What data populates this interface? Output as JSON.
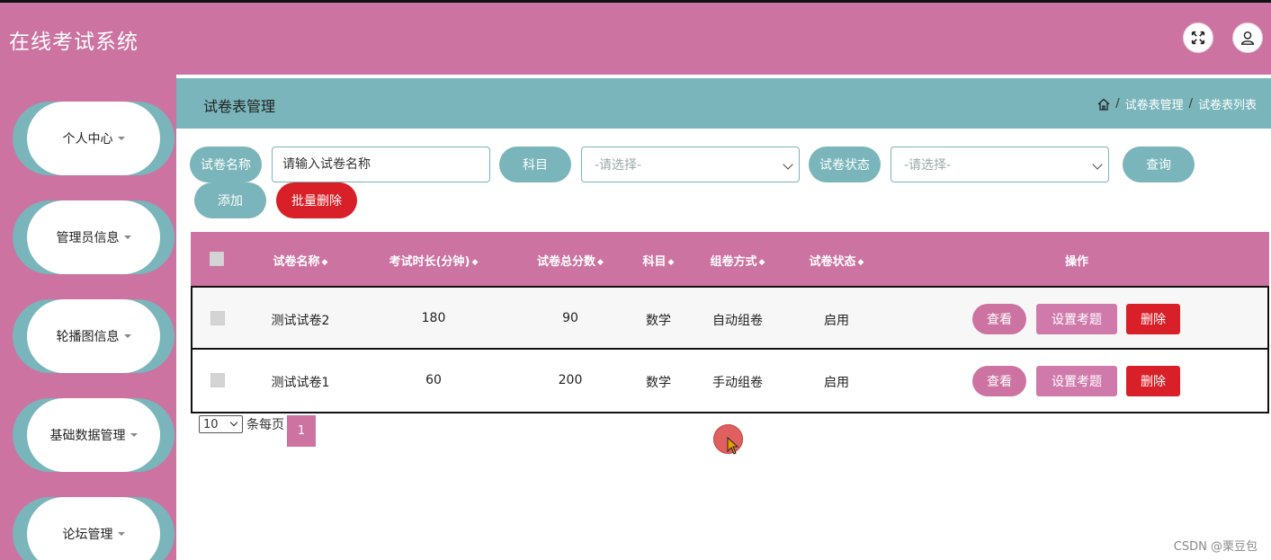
{
  "app": {
    "title": "在线考试系统"
  },
  "header": {
    "fullscreen_icon": "expand-icon",
    "user_icon": "user-icon"
  },
  "sidebar": {
    "items": [
      {
        "label": "个人中心"
      },
      {
        "label": "管理员信息"
      },
      {
        "label": "轮播图信息"
      },
      {
        "label": "基础数据管理"
      },
      {
        "label": "论坛管理"
      }
    ]
  },
  "page": {
    "title": "试卷表管理",
    "breadcrumb": [
      "试卷表管理",
      "试卷表列表"
    ],
    "breadcrumb_sep": "/"
  },
  "search": {
    "name_label": "试卷名称",
    "name_placeholder": "请输入试卷名称",
    "subject_label": "科目",
    "subject_value": "-请选择-",
    "status_label": "试卷状态",
    "status_value": "-请选择-",
    "query_label": "查询",
    "add_label": "添加",
    "batch_delete_label": "批量删除"
  },
  "table": {
    "columns": [
      "试卷名称",
      "考试时长(分钟)",
      "试卷总分数",
      "科目",
      "组卷方式",
      "试卷状态",
      "操作"
    ],
    "sort_glyph": "◆",
    "rows": [
      {
        "name": "测试试卷2",
        "duration": "180",
        "score": "90",
        "subject": "数学",
        "mode": "自动组卷",
        "status": "启用"
      },
      {
        "name": "测试试卷1",
        "duration": "60",
        "score": "200",
        "subject": "数学",
        "mode": "手动组卷",
        "status": "启用"
      }
    ],
    "actions": {
      "view": "查看",
      "set_questions": "设置考题",
      "delete": "删除"
    }
  },
  "pagination": {
    "page_size": "10",
    "per_page_label": "条每页",
    "current_page": "1"
  },
  "watermark": "CSDN @栗豆包",
  "colors": {
    "pink": "#cc73a1",
    "teal": "#79b5ba",
    "red": "#d91f27"
  }
}
